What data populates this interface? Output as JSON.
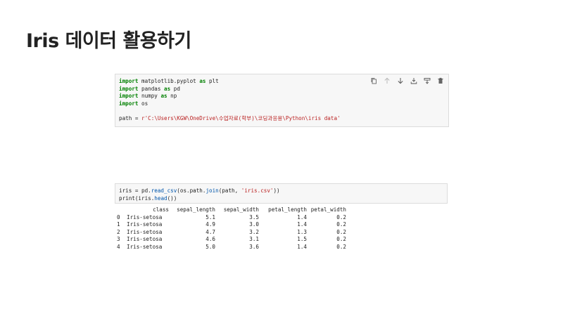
{
  "slide": {
    "title": "Iris 데이터 활용하기"
  },
  "cell1": {
    "line1": {
      "kw": "import",
      "rest": " matplotlib.pyplot ",
      "kw2": "as",
      "rest2": " plt"
    },
    "line2": {
      "kw": "import",
      "rest": " pandas ",
      "kw2": "as",
      "rest2": " pd"
    },
    "line3": {
      "kw": "import",
      "rest": " numpy ",
      "kw2": "as",
      "rest2": " np"
    },
    "line4": {
      "kw": "import",
      "rest": " os"
    },
    "line6": {
      "prefix": "path = ",
      "str": "r'C:\\Users\\KGW\\OneDrive\\수업자료(학부)\\코딩과응용\\Python\\iris data'"
    },
    "toolbar_icons": [
      "copy-icon",
      "arrow-up-icon",
      "arrow-down-icon",
      "download-icon",
      "split-icon",
      "trash-icon"
    ]
  },
  "cell2": {
    "line1": {
      "a": "iris = pd.",
      "fn": "read_csv",
      "b": "(os.path.",
      "fn2": "join",
      "c": "(path, ",
      "str": "'iris.csv'",
      "d": "))"
    },
    "line2": {
      "a": "print(iris.",
      "fn": "head",
      "b": "())"
    }
  },
  "output": {
    "columns": [
      "class",
      "sepal_length",
      "sepal_width",
      "petal_length",
      "petal_width"
    ],
    "rows": [
      [
        "0",
        "Iris-setosa",
        "5.1",
        "3.5",
        "1.4",
        "0.2"
      ],
      [
        "1",
        "Iris-setosa",
        "4.9",
        "3.0",
        "1.4",
        "0.2"
      ],
      [
        "2",
        "Iris-setosa",
        "4.7",
        "3.2",
        "1.3",
        "0.2"
      ],
      [
        "3",
        "Iris-setosa",
        "4.6",
        "3.1",
        "1.5",
        "0.2"
      ],
      [
        "4",
        "Iris-setosa",
        "5.0",
        "3.6",
        "1.4",
        "0.2"
      ]
    ]
  }
}
